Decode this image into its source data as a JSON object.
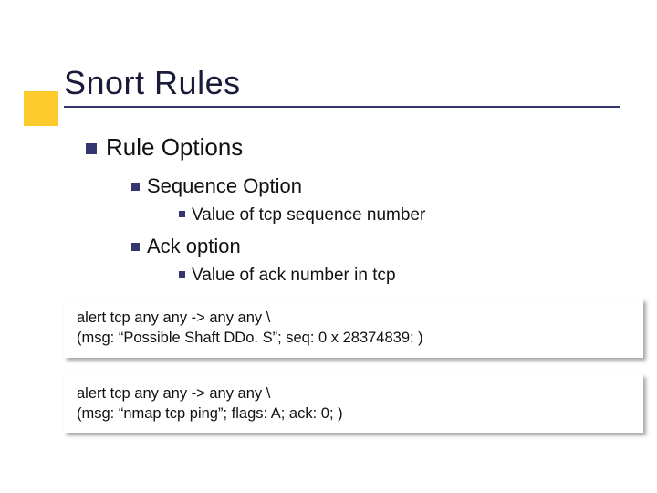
{
  "title": "Snort Rules",
  "bullets": {
    "lvl1": "Rule Options",
    "seq_title": "Sequence Option",
    "seq_detail": "Value of tcp sequence number",
    "ack_title": "Ack option",
    "ack_detail": "Value of ack number in tcp"
  },
  "code1": {
    "line1": "alert tcp any any -> any any \\",
    "line2": "(msg: “Possible Shaft DDo. S”; seq: 0 x 28374839; )"
  },
  "code2": {
    "line1": "alert tcp any any -> any any \\",
    "line2": "(msg: “nmap tcp ping”; flags: A; ack: 0; )"
  }
}
